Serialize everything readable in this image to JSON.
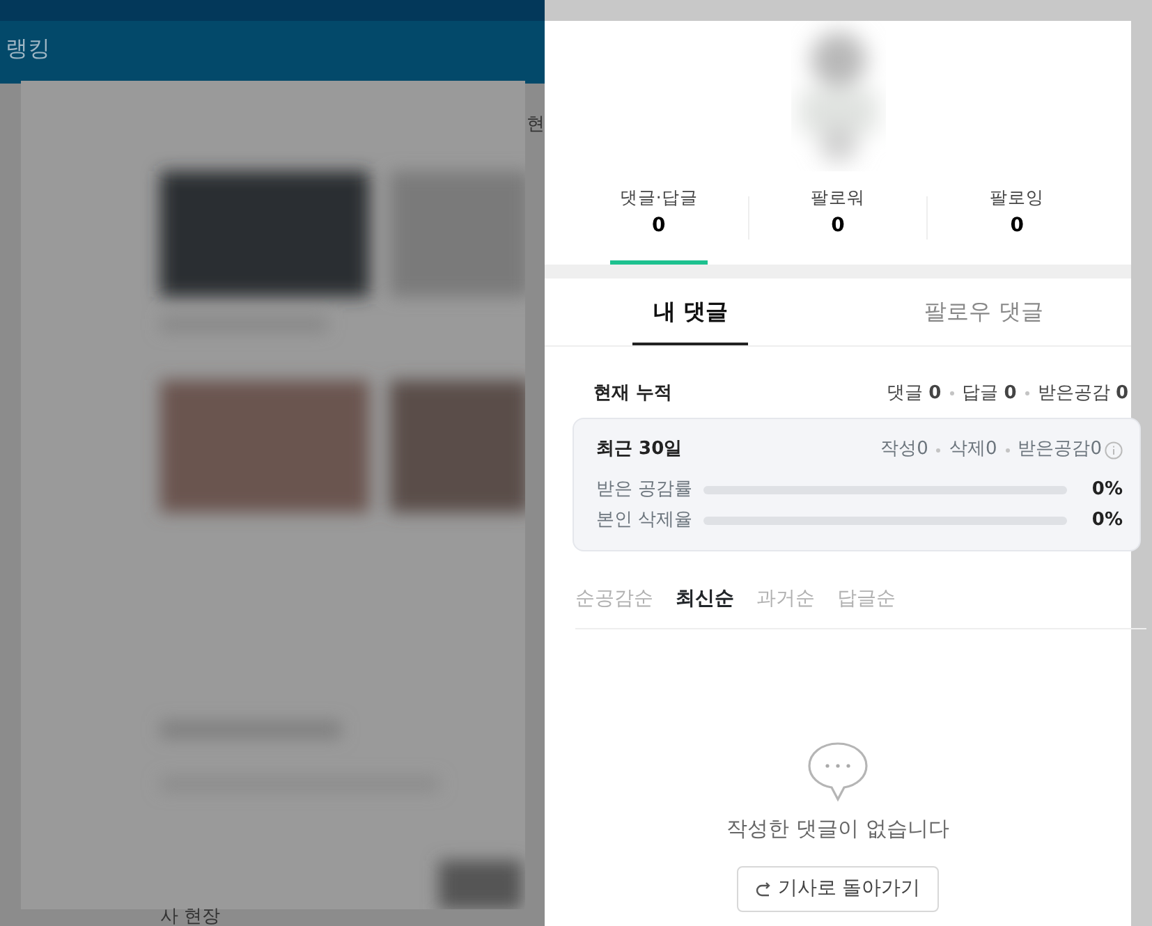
{
  "background_page": {
    "header_title": "랭킹",
    "fragments": [
      "현",
      "사 현장"
    ]
  },
  "stats": [
    {
      "label": "댓글·답글",
      "value": "0",
      "selected": true
    },
    {
      "label": "팔로워",
      "value": "0",
      "selected": false
    },
    {
      "label": "팔로잉",
      "value": "0",
      "selected": false
    }
  ],
  "tabs": [
    {
      "label": "내 댓글",
      "selected": true
    },
    {
      "label": "팔로우 댓글",
      "selected": false
    }
  ],
  "cumulative": {
    "title": "현재 누적",
    "items": [
      {
        "label": "댓글",
        "value": "0"
      },
      {
        "label": "답글",
        "value": "0"
      },
      {
        "label": "받은공감",
        "value": "0"
      }
    ]
  },
  "recent": {
    "title": "최근 30일",
    "items": [
      {
        "label": "작성",
        "value": "0"
      },
      {
        "label": "삭제",
        "value": "0"
      },
      {
        "label": "받은공감",
        "value": "0"
      }
    ],
    "bars": [
      {
        "label": "받은 공감률",
        "level": 0,
        "reading": "0%"
      },
      {
        "label": "본인 삭제율",
        "level": 0,
        "reading": "0%"
      }
    ]
  },
  "sort_options": [
    {
      "label": "순공감순",
      "selected": false
    },
    {
      "label": "최신순",
      "selected": true
    },
    {
      "label": "과거순",
      "selected": false
    },
    {
      "label": "답글순",
      "selected": false
    }
  ],
  "empty_state": {
    "message": "작성한 댓글이 없습니다",
    "button": "기사로 돌아가기"
  }
}
